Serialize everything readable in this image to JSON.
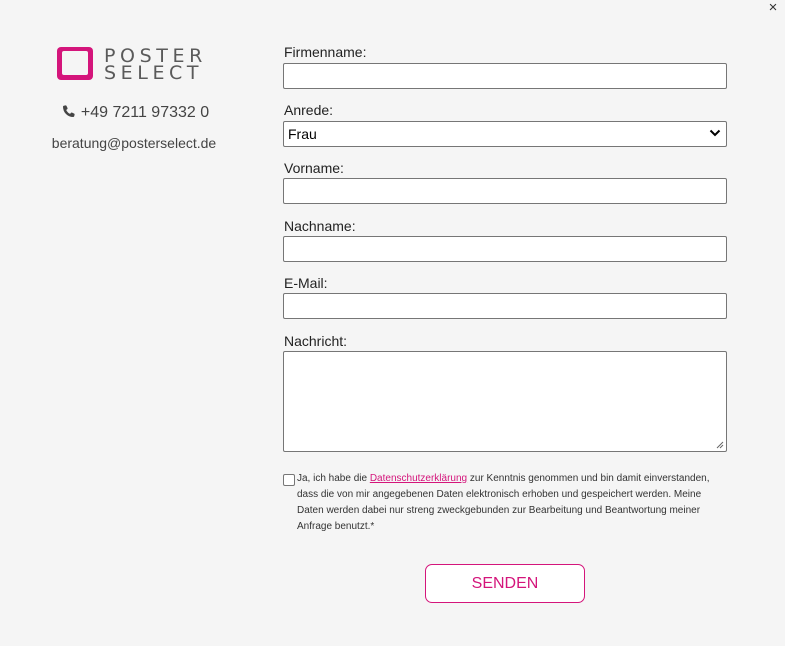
{
  "window": {
    "close_icon": "close-icon",
    "close_glyph": "×"
  },
  "brand": {
    "line1": "POSTER",
    "line2": "SELECT",
    "accent_color": "#d4157b"
  },
  "contact": {
    "phone_icon": "phone-icon",
    "phone": "+49 7211 97332 0",
    "email": "beratung@posterselect.de"
  },
  "form": {
    "company": {
      "label": "Firmenname:",
      "value": ""
    },
    "salutation": {
      "label": "Anrede:",
      "value": "Frau"
    },
    "firstname": {
      "label": "Vorname:",
      "value": ""
    },
    "lastname": {
      "label": "Nachname:",
      "value": ""
    },
    "email": {
      "label": "E-Mail:",
      "value": ""
    },
    "message": {
      "label": "Nachricht:",
      "value": ""
    },
    "consent": {
      "checked": false,
      "text_before": "Ja, ich habe die ",
      "link": "Datenschutzerklärung",
      "text_after": " zur Kenntnis genommen und bin damit einverstanden, dass die von mir angegebenen Daten elektronisch erhoben und gespeichert werden. Meine Daten werden dabei nur streng zweckgebunden zur Bearbeitung und Beantwortung meiner Anfrage benutzt.*"
    },
    "submit_label": "SENDEN"
  }
}
